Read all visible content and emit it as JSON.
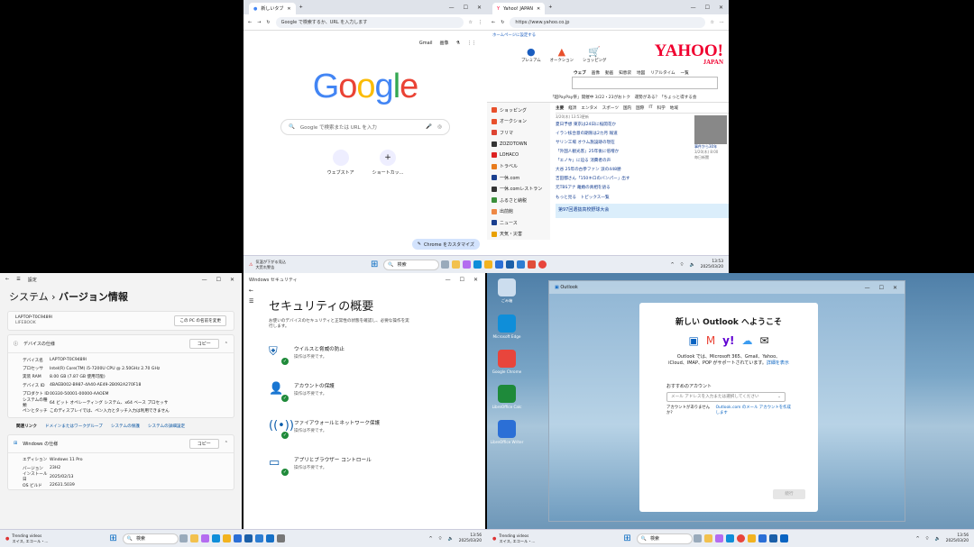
{
  "chrome": {
    "tab": "新しいタブ",
    "address": "Google で検索するか、URL を入力します",
    "links": [
      "Gmail",
      "画像"
    ],
    "logo": "Google",
    "search_placeholder": "Google で検索または URL を入力",
    "shortcuts": [
      "ウェブストア",
      "ショートカッ..."
    ],
    "customize": "Chrome をカスタマイズ"
  },
  "edge": {
    "tab": "Yahoo! JAPAN",
    "url": "https://www.yahoo.co.jp",
    "homepage": "ホームページに設定する",
    "icons": [
      "プレミアム",
      "オークション",
      "ショッピング"
    ],
    "logo": "YAHOO!",
    "logo_sub": "JAPAN",
    "searchtabs": [
      "ウェブ",
      "画像",
      "動画",
      "知恵袋",
      "地図",
      "リアルタイム",
      "一覧"
    ],
    "promo": "「超PayPay祭」開催中 3/22・23がおトク",
    "promo2": "運勢がある？「ちょっと得する会",
    "sidebar": [
      "ショッピング",
      "オークション",
      "フリマ",
      "ZOZOTOWN",
      "LOHACO",
      "トラベル",
      "一休.com",
      "一休.comレストラン",
      "ふるさと納税",
      "出前館",
      "ニュース",
      "天気・災害"
    ],
    "sidecolors": [
      "#e8502c",
      "#e8502c",
      "#d43",
      "#333",
      "#d22",
      "#e87b1c",
      "#1a3f8f",
      "#333",
      "#3a8f3a",
      "#e84",
      "#1a3f8f",
      "#e8a000"
    ],
    "newstabs": [
      "主要",
      "経済",
      "エンタメ",
      "スポーツ",
      "国内",
      "国際",
      "IT",
      "科学",
      "地域"
    ],
    "date": "3/20(木) 13:53更新",
    "headlines": [
      "夏日予想 東京は24日に桜開花か",
      "イラン核合意の期限は2カ月 報道",
      "サリン工場 オウム施設跡の現在",
      "「外国人観光客」25年後に倍増か",
      "「エノキ」に迫る 消費者の声",
      "大谷 25年の古参ファン 涙の448勝",
      "吉田都さん「150キロのバンパー」出す",
      "元TBSアナ 離婚の真相を語る"
    ],
    "more": "もっと見る　トピックス一覧",
    "caption": "事件から30年",
    "caption2": "3/20(木) 8:00",
    "caption3": "毎日新聞",
    "banner": "第97回選抜高校野球大会"
  },
  "taskbar_top": {
    "alert": "気温が下がる見込",
    "alert2": "大荒れ警告",
    "search": "検索",
    "time": "13:53",
    "date": "2025/03/20"
  },
  "settings": {
    "app": "設定",
    "breadcrumb1": "システム",
    "breadcrumb2": "バージョン情報",
    "device": "LAPTOP-T0C9489I",
    "device_sub": "LIFEBOOK",
    "rename": "この PC の名前を変更",
    "spec_title": "デバイスの仕様",
    "copy": "コピー",
    "specs": [
      [
        "デバイス名",
        "LAPTOP-T0C9489I"
      ],
      [
        "プロセッサ",
        "Intel(R) Core(TM) i5-7200U CPU @ 2.50GHz   2.70 GHz"
      ],
      [
        "実装 RAM",
        "8.00 GB (7.87 GB 使用可能)"
      ],
      [
        "デバイス ID",
        "4BAEB002-B987-4A40-AE49-2B092A270F18"
      ],
      [
        "プロダクト ID",
        "00330-50001-00000-AAOEM"
      ],
      [
        "システムの種類",
        "64 ビット オペレーティング システム、x64 ベース プロセッサ"
      ],
      [
        "ペンとタッチ",
        "このディスプレイでは、ペン入力とタッチ入力は利用できません"
      ]
    ],
    "related": [
      "関連リンク",
      "ドメインまたはワークグループ",
      "システムの保護",
      "システムの詳細設定"
    ],
    "win_title": "Windows の仕様",
    "win": [
      [
        "エディション",
        "Windows 11 Pro"
      ],
      [
        "バージョン",
        "23H2"
      ],
      [
        "インストール日",
        "2025/02/13"
      ],
      [
        "OS ビルド",
        "22631.5039"
      ]
    ]
  },
  "security": {
    "app": "Windows セキュリティ",
    "title": "セキュリティの概要",
    "desc": "お使いのデバイスのセキュリティと正常性の状態を確認し、必要な操作を実行します。",
    "items": [
      [
        "ウイルスと脅威の防止",
        "操作は不要です。"
      ],
      [
        "アカウントの保護",
        "操作は不要です。"
      ],
      [
        "ファイアウォールとネットワーク保護",
        "操作は不要です。"
      ],
      [
        "アプリとブラウザー コントロール",
        "操作は不要です。"
      ]
    ]
  },
  "desktop": {
    "icons": [
      "ごみ箱",
      "Microsoft Edge",
      "Google Chrome",
      "LibreOffice Calc",
      "LibreOffice Writer"
    ]
  },
  "outlook": {
    "app": "Outlook",
    "title": "新しい Outlook へようこそ",
    "desc": "Outlook では、Microsoft 365、Gmail、Yahoo、iCloud、IMAP、POP がサポートされています。",
    "link": "詳細を表示",
    "label": "おすすめのアカウント",
    "placeholder": "メール アドレスを入力または選択してください",
    "noacc": "アカウントがありませんか?",
    "create": "Outlook.com のメール アカウントを作成します",
    "next": "続行"
  },
  "taskbar_bottom": {
    "weather": "Trending videos",
    "weather2": "スイス, エコール・...",
    "search": "検索",
    "time": "13:56",
    "date": "2025/03/20"
  }
}
